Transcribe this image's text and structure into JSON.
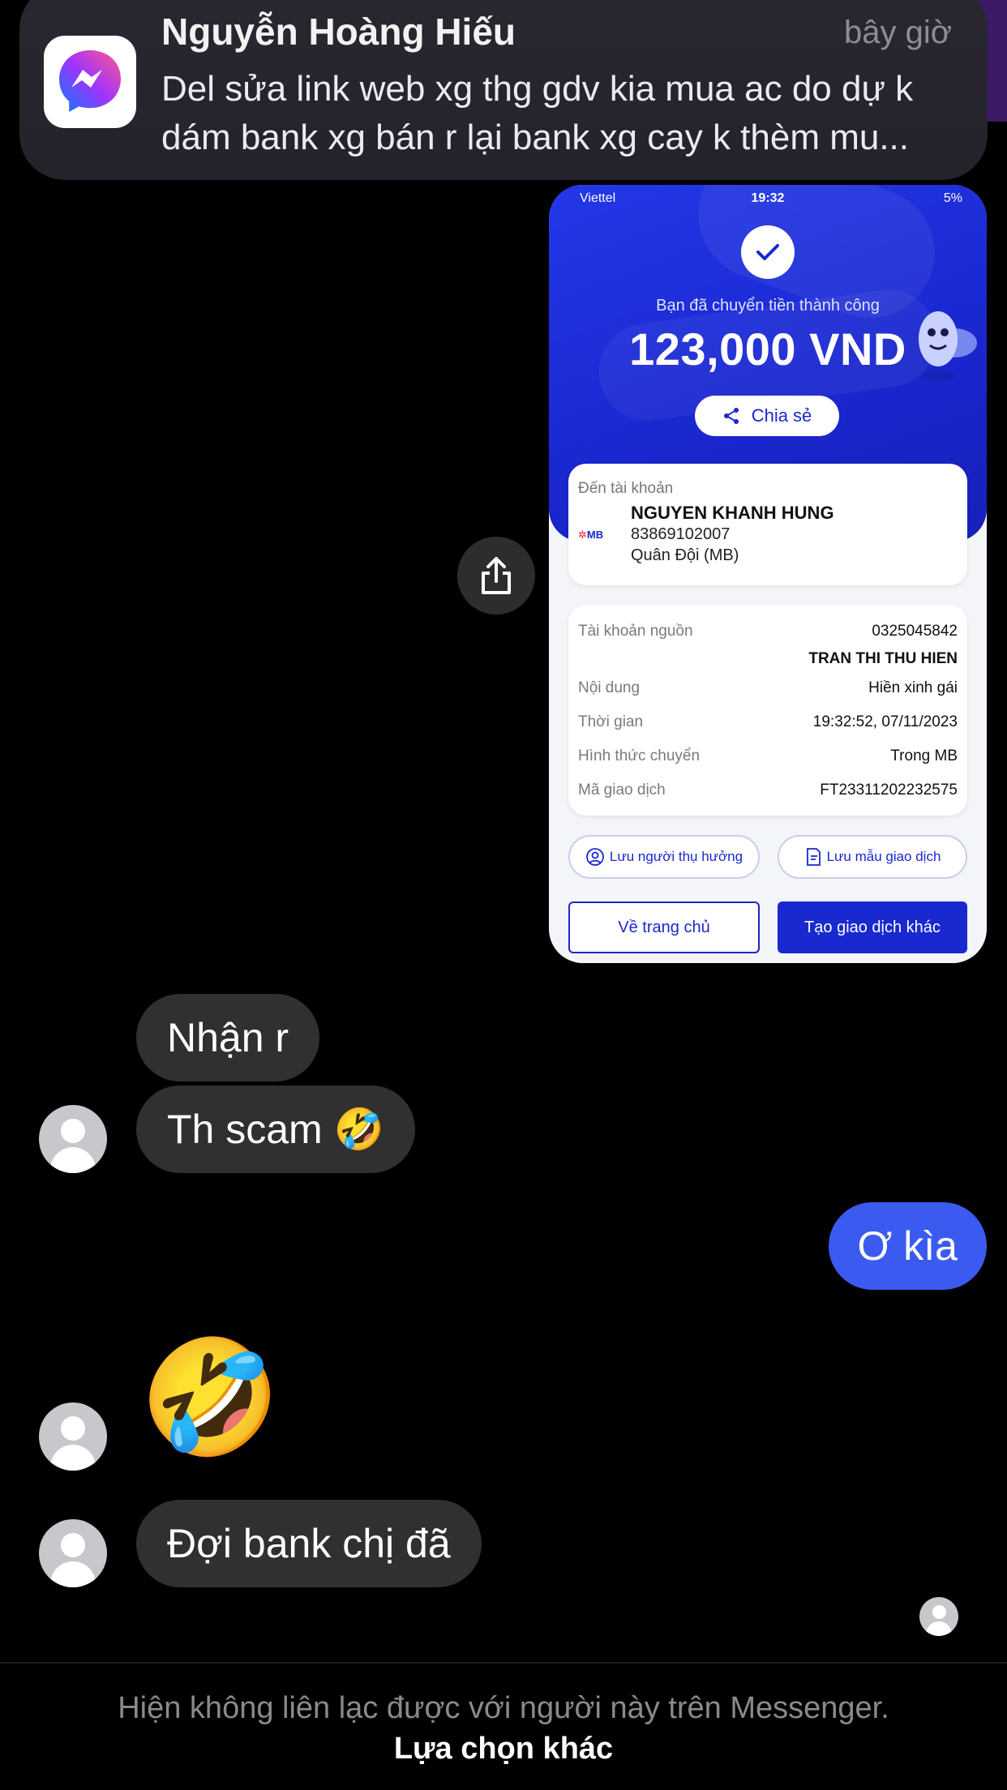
{
  "notification": {
    "app_icon": "messenger-icon",
    "sender": "Nguyễn Hoàng Hiếu",
    "time": "bây giờ",
    "message_line1": "Del sửa link web xg thg gdv kia mua ac do dự k",
    "message_line2": "dám bank xg bán r lại bank xg cay k thèm mu..."
  },
  "receipt": {
    "status_bar": {
      "carrier": "Viettel",
      "time": "19:32",
      "battery": "5%"
    },
    "success_text": "Bạn đã chuyển tiền thành công",
    "amount": "123,000 VND",
    "share_label": "Chia sẻ",
    "to_account_label": "Đến tài khoản",
    "bank_logo": "MB",
    "recipient_name": "NGUYEN KHANH HUNG",
    "recipient_account": "83869102007",
    "recipient_bank": "Quân Đội (MB)",
    "details": {
      "source_label": "Tài khoản nguồn",
      "source_account": "0325045842",
      "source_name": "TRAN THI THU HIEN",
      "content_label": "Nội dung",
      "content_value": "Hiền xinh gái",
      "time_label": "Thời gian",
      "time_value": "19:32:52, 07/11/2023",
      "method_label": "Hình thức chuyển",
      "method_value": "Trong MB",
      "txn_label": "Mã giao dịch",
      "txn_value": "FT23311202232575"
    },
    "save_beneficiary": "Lưu người thụ hưởng",
    "save_template": "Lưu mẫu giao dịch",
    "home_button": "Về trang chủ",
    "new_txn_button": "Tạo giao dịch khác",
    "colors": {
      "primary": "#1a28d0",
      "background": "#f4f5f9"
    }
  },
  "messages": [
    {
      "direction": "incoming",
      "text": "Nhận r"
    },
    {
      "direction": "incoming",
      "text": "Th scam 🤣"
    },
    {
      "direction": "outgoing",
      "text": "Ơ kìa"
    },
    {
      "direction": "incoming",
      "text": "🤣"
    },
    {
      "direction": "incoming",
      "text": "Đợi bank chị đã"
    }
  ],
  "footer": {
    "notice": "Hiện không liên lạc được với người này trên Messenger.",
    "action": "Lựa chọn khác"
  },
  "colors": {
    "outgoing_bubble": "#3b5bf0",
    "incoming_bubble": "#303030",
    "background": "#000000"
  }
}
